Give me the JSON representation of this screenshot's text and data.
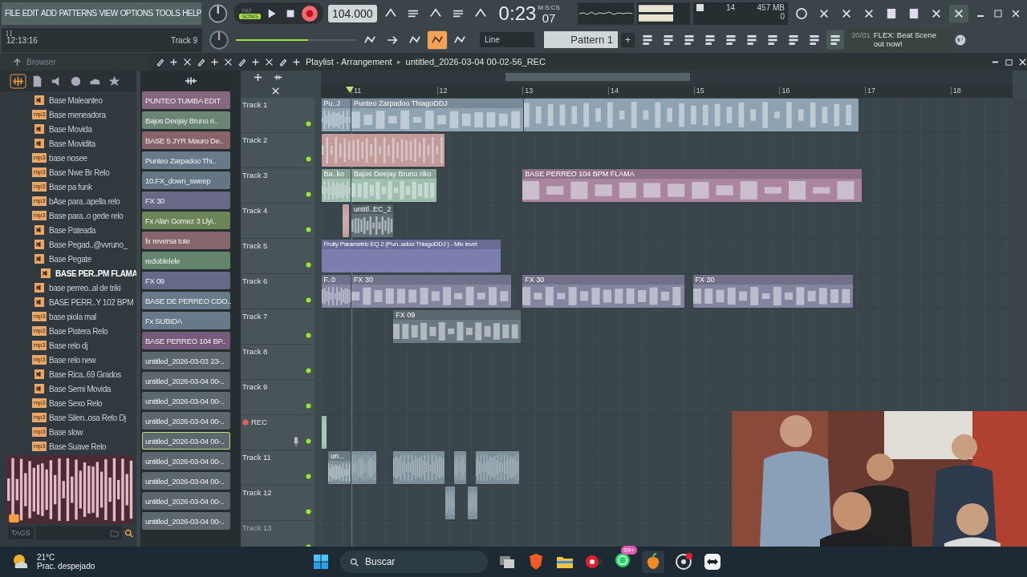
{
  "menu": [
    "FILE",
    "EDIT",
    "ADD",
    "PATTERNS",
    "VIEW",
    "OPTIONS",
    "TOOLS",
    "HELP"
  ],
  "hint": {
    "brackets": "[   ]",
    "clock": "12:13:16",
    "track": "Track 9"
  },
  "transport": {
    "pat": "PAT",
    "song": "SONG",
    "mode_song": true,
    "recording": true,
    "tempo": "104.000"
  },
  "time": {
    "main": "0:23",
    "cs": "07",
    "unit": "M:S:CS"
  },
  "cpu": {
    "polyphony": "14",
    "memory": "457 MB",
    "voices": "0"
  },
  "snap": "Line",
  "pattern": {
    "name": "Pattern 1",
    "add": "+"
  },
  "news": {
    "date": "30/01",
    "text": "FLEX: Beat Scene out now!"
  },
  "master_volume": {
    "level": 0.6
  },
  "browser": {
    "title": "Browser",
    "tabs": [
      {
        "kind": "audio",
        "selected": true
      },
      {
        "kind": "files",
        "selected": false
      },
      {
        "kind": "plugins",
        "selected": false
      },
      {
        "kind": "web",
        "selected": false
      },
      {
        "kind": "cloud",
        "selected": false
      },
      {
        "kind": "star",
        "selected": false
      }
    ],
    "items": [
      {
        "kind": "pattern",
        "name": "Base Maleanteo",
        "selected": false
      },
      {
        "kind": "audio",
        "badge": "mp3",
        "name": "Base meneadora",
        "selected": false
      },
      {
        "kind": "pattern",
        "name": "Base Movida",
        "selected": false
      },
      {
        "kind": "pattern",
        "name": "Base Movidita",
        "selected": false
      },
      {
        "kind": "audio",
        "badge": "mp3",
        "name": "base nosee",
        "selected": false
      },
      {
        "kind": "audio",
        "badge": "mp3",
        "name": "Base Nwe Br Relo",
        "selected": false
      },
      {
        "kind": "audio",
        "badge": "mp3",
        "name": "Base pa funk",
        "selected": false
      },
      {
        "kind": "audio",
        "badge": "mp3",
        "name": "bAse para..apella relo",
        "selected": false
      },
      {
        "kind": "audio",
        "badge": "mp3",
        "name": "Base para..o gede relo",
        "selected": false
      },
      {
        "kind": "pattern",
        "name": "Base Pateada",
        "selected": false
      },
      {
        "kind": "pattern",
        "name": "Base Pegad..@vvruno_",
        "selected": false
      },
      {
        "kind": "pattern",
        "name": "Base Pegate",
        "selected": false
      },
      {
        "kind": "pattern",
        "name": "BASE PER..PM FLAMA",
        "selected": true
      },
      {
        "kind": "pattern",
        "name": "base perreo..al de triki",
        "selected": false
      },
      {
        "kind": "pattern",
        "name": "BASE PERR..Y 102 BPM",
        "selected": false
      },
      {
        "kind": "audio",
        "badge": "mp3",
        "name": "base piola mal",
        "selected": false
      },
      {
        "kind": "audio",
        "badge": "mp3",
        "name": "Base Pistera Relo",
        "selected": false
      },
      {
        "kind": "audio",
        "badge": "mp3",
        "name": "Base relo dj",
        "selected": false
      },
      {
        "kind": "audio",
        "badge": "mp3",
        "name": "Base relo new",
        "selected": false
      },
      {
        "kind": "pattern",
        "name": "Base Rica..69 Grados",
        "selected": false
      },
      {
        "kind": "pattern",
        "name": "Base Semi Movida",
        "selected": false
      },
      {
        "kind": "audio",
        "badge": "mp3",
        "name": "Base Sexo Relo",
        "selected": false
      },
      {
        "kind": "audio",
        "badge": "mp3",
        "name": "Base Silen..osa Relo Dj",
        "selected": false
      },
      {
        "kind": "audio",
        "badge": "mp3",
        "name": "Base slow",
        "selected": false
      },
      {
        "kind": "audio",
        "badge": "mp3",
        "name": "Base Suave Relo",
        "selected": false
      }
    ],
    "tags_label": "TAGS"
  },
  "channels": [
    {
      "name": "PUNTEO TUMBA EDIT",
      "color": "#85687f",
      "selected": false
    },
    {
      "name": "Bajos Deejay Bruno ri..",
      "color": "#6a8574",
      "selected": false
    },
    {
      "name": "BASE 5 JYR Mauro De..",
      "color": "#866469",
      "selected": false
    },
    {
      "name": "Punteo Zarpadoo Thi..",
      "color": "#68798a",
      "selected": false
    },
    {
      "name": "10.FX_down_sweep",
      "color": "#647584",
      "selected": false
    },
    {
      "name": "FX 30",
      "color": "#686a88",
      "selected": false
    },
    {
      "name": "Fx Alan Gomez 3 Llyi..",
      "color": "#6c8558",
      "selected": false
    },
    {
      "name": "fx reversa tote",
      "color": "#85666c",
      "selected": false
    },
    {
      "name": "redoblelele",
      "color": "#64846c",
      "selected": false
    },
    {
      "name": "FX 09",
      "color": "#666a88",
      "selected": false
    },
    {
      "name": "BASE DE PERREO CDO..",
      "color": "#68798a",
      "selected": false
    },
    {
      "name": "Fx SUBIDA",
      "color": "#68798a",
      "selected": false
    },
    {
      "name": "BASE PERREO 104 BP..",
      "color": "#765a7c",
      "selected": false
    },
    {
      "name": "untitled_2026-03-03 23-..",
      "color": "#5d686e",
      "selected": false
    },
    {
      "name": "untitled_2026-03-04 00-..",
      "color": "#5d686e",
      "selected": false
    },
    {
      "name": "untitled_2026-03-04 00-..",
      "color": "#5d686e",
      "selected": false
    },
    {
      "name": "untitled_2026-03-04 00-..",
      "color": "#5d686e",
      "selected": false
    },
    {
      "name": "untitled_2026-03-04 00-..",
      "color": "#5d686e",
      "selected": true
    },
    {
      "name": "untitled_2026-03-04 00-..",
      "color": "#5d686e",
      "selected": false
    },
    {
      "name": "untitled_2026-03-04 00-..",
      "color": "#5d686e",
      "selected": false
    },
    {
      "name": "untitled_2026-03-04 00-..",
      "color": "#5d686e",
      "selected": false
    },
    {
      "name": "untitled_2026-03-04 00-..",
      "color": "#5d686e",
      "selected": false
    }
  ],
  "playlist": {
    "title": "Playlist - Arrangement",
    "separator": "▸",
    "project": "untitled_2026-03-04 00-02-56_REC",
    "ruler": [
      "11",
      "12",
      "13",
      "14",
      "15",
      "16",
      "17",
      "18"
    ],
    "tracks": [
      {
        "name": "Track 1",
        "clips": [
          {
            "kind": "audio",
            "name": "Pu..J",
            "color": "#8fa2b2"
          },
          {
            "kind": "audio",
            "name": "Punteo Zarpadoo ThiagoDDJ",
            "color": "#8fa2b2"
          },
          {
            "kind": "chops",
            "color": "#8fa2b2"
          }
        ]
      },
      {
        "name": "Track 2",
        "clips": [
          {
            "kind": "chops",
            "color": "#c49b9b"
          }
        ]
      },
      {
        "name": "Track 3",
        "clips": [
          {
            "kind": "audio",
            "name": "Ba..ko",
            "color": "#9fbfae"
          },
          {
            "kind": "audio",
            "name": "Bajos Deejay Bruno riko",
            "color": "#9fbfae"
          },
          {
            "kind": "audio",
            "name": "BASE PERREO 104 BPM FLAMA",
            "color": "#a9859f"
          }
        ]
      },
      {
        "name": "Track 4",
        "clips": [
          {
            "kind": "chops",
            "color": "#c49b9b"
          },
          {
            "kind": "audio",
            "name": "untitl..EC_2",
            "color": "#5f6e74"
          }
        ]
      },
      {
        "name": "Track 5",
        "clips": [
          {
            "kind": "automation",
            "name": "Fruity Parametric EQ 2 (Pun..adoo ThiagoDDJ ) - Mix level",
            "color": "#7c7fae"
          }
        ]
      },
      {
        "name": "Track 6",
        "clips": [
          {
            "kind": "audio",
            "name": "F..0",
            "color": "#8484a0"
          },
          {
            "kind": "audio",
            "name": "FX 30",
            "color": "#8484a0"
          },
          {
            "kind": "audio",
            "name": "FX 30",
            "color": "#8484a0"
          },
          {
            "kind": "audio",
            "name": "FX 30",
            "color": "#8484a0"
          }
        ]
      },
      {
        "name": "Track 7",
        "clips": [
          {
            "kind": "audio",
            "name": "FX 09",
            "color": "#6b7a82"
          }
        ]
      },
      {
        "name": "Track 8"
      },
      {
        "name": "Track 9"
      },
      {
        "name": "REC",
        "recording": true,
        "clips": [
          {
            "kind": "chops",
            "color": "#9fbfae"
          }
        ]
      },
      {
        "name": "Track 11",
        "clips": [
          {
            "kind": "audio",
            "name": "un...",
            "color": "#7d8f99"
          },
          {
            "kind": "chops",
            "color": "#7d8f99"
          },
          {
            "kind": "chops",
            "color": "#7d8f99"
          },
          {
            "kind": "chops",
            "color": "#7d8f99"
          },
          {
            "kind": "chops",
            "color": "#7d8f99"
          }
        ]
      },
      {
        "name": "Track 12",
        "clips": [
          {
            "kind": "chops",
            "color": "#7d8f99"
          },
          {
            "kind": "chops",
            "color": "#7d8f99"
          }
        ]
      },
      {
        "name": "Track 13"
      }
    ]
  },
  "taskbar": {
    "temperature": "21°C",
    "weather": "Prac. despejado",
    "search": "Buscar",
    "badge": "99+"
  }
}
